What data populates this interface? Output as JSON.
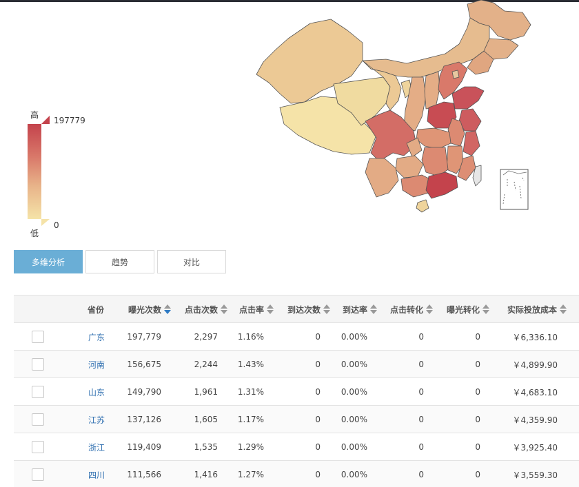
{
  "legend": {
    "high_label": "高",
    "low_label": "低",
    "max_value": "197779",
    "min_value": "0",
    "colors": {
      "high": "#c4434c",
      "low": "#f5e3a8"
    }
  },
  "tabs": [
    {
      "label": "多维分析",
      "active": true
    },
    {
      "label": "趋势",
      "active": false
    },
    {
      "label": "对比",
      "active": false
    }
  ],
  "table": {
    "headers": [
      "省份",
      "曝光次数",
      "点击次数",
      "点击率",
      "到达次数",
      "到达率",
      "点击转化",
      "曝光转化",
      "实际投放成本"
    ],
    "sorted_column": "曝光次数",
    "sort_direction": "desc",
    "rows": [
      {
        "province": "广东",
        "impressions": "197,779",
        "clicks": "2,297",
        "ctr": "1.16%",
        "arrivals": "0",
        "arrival_rate": "0.00%",
        "click_conv": "0",
        "imp_conv": "0",
        "cost": "￥6,336.10"
      },
      {
        "province": "河南",
        "impressions": "156,675",
        "clicks": "2,244",
        "ctr": "1.43%",
        "arrivals": "0",
        "arrival_rate": "0.00%",
        "click_conv": "0",
        "imp_conv": "0",
        "cost": "￥4,899.90"
      },
      {
        "province": "山东",
        "impressions": "149,790",
        "clicks": "1,961",
        "ctr": "1.31%",
        "arrivals": "0",
        "arrival_rate": "0.00%",
        "click_conv": "0",
        "imp_conv": "0",
        "cost": "￥4,683.10"
      },
      {
        "province": "江苏",
        "impressions": "137,126",
        "clicks": "1,605",
        "ctr": "1.17%",
        "arrivals": "0",
        "arrival_rate": "0.00%",
        "click_conv": "0",
        "imp_conv": "0",
        "cost": "￥4,359.90"
      },
      {
        "province": "浙江",
        "impressions": "119,409",
        "clicks": "1,535",
        "ctr": "1.29%",
        "arrivals": "0",
        "arrival_rate": "0.00%",
        "click_conv": "0",
        "imp_conv": "0",
        "cost": "￥3,925.40"
      },
      {
        "province": "四川",
        "impressions": "111,566",
        "clicks": "1,416",
        "ctr": "1.27%",
        "arrivals": "0",
        "arrival_rate": "0.00%",
        "click_conv": "0",
        "imp_conv": "0",
        "cost": "￥3,559.30"
      }
    ]
  }
}
